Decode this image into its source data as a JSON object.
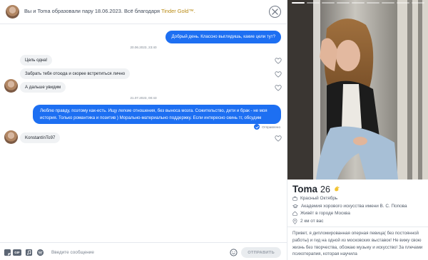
{
  "header": {
    "prefix": "Вы и ",
    "name": "Toma",
    "middle": " образовали пару 18.06.2023. Всё благодаря ",
    "brand": "Tinder Gold",
    "suffix": "™."
  },
  "messages": {
    "m1": "Добрый день. Классно выглядишь, какие цели тут?",
    "stamp1": "20.06.2023, 23:40",
    "m2": "Цель одна!",
    "m3": "Забрать тебя отсюда и скорее встретиться лично",
    "m4": "А дальше увидим",
    "stamp2": "21.07.2023, 00:43",
    "m5": "Люблю правду, поэтому как-есть. Ищу легкие отношения, без выноса мозга. Сожительство, дети и брак - не моя история. Только романтика и позитив ) Морально-материально поддержку. Если интересно скинь тг, обсудим",
    "sent_status": "Отправлено",
    "m6": "KonstantínTo97"
  },
  "composer": {
    "placeholder": "Введите сообщение",
    "gif_label": "GIF",
    "send_label": "ОТПРАВИТЬ"
  },
  "profile": {
    "name": "Toma",
    "age": "26",
    "info": {
      "place": "Красный Октябрь",
      "school": "Академия хорового искусства имени В. С. Попова",
      "city": "Живёт в городе Москва",
      "distance": "2 км от вас"
    },
    "bio": "Привет, я дипломированная оперная певица( без постоянной работы) и гид на одной из московских выставок! Не вижу свою жизнь без творчества, обожаю музыку и искусство! За плечами психотерапия, которая научила"
  },
  "colors": {
    "accent": "#1d6ff2",
    "gold": "#b98a13"
  }
}
